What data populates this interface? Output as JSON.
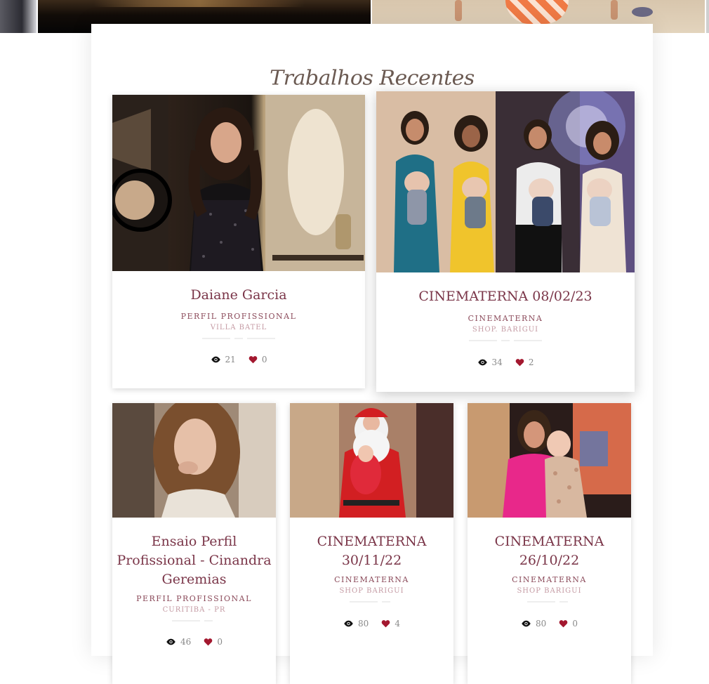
{
  "section": {
    "title": "Trabalhos Recentes"
  },
  "colors": {
    "title": "#7a3548",
    "category": "#8b4a5a",
    "location": "#c49aa3",
    "heart": "#a3182f"
  },
  "icons": {
    "views": "eye-icon",
    "likes": "heart-icon"
  },
  "cards": [
    {
      "title": "Daiane Garcia",
      "category": "PERFIL PROFISSIONAL",
      "location": "VILLA BATEL",
      "views": "21",
      "likes": "0"
    },
    {
      "title": "CINEMATERNA 08/02/23",
      "category": "CINEMATERNA",
      "location": "SHOP. BARIGUI",
      "views": "34",
      "likes": "2"
    },
    {
      "title": "Ensaio Perfil Profissional - Cinandra Geremias",
      "category": "PERFIL PROFISSIONAL",
      "location": "CURITIBA - PR",
      "views": "46",
      "likes": "0"
    },
    {
      "title": "CINEMATERNA 30/11/22",
      "category": "CINEMATERNA",
      "location": "SHOP BARIGUI",
      "views": "80",
      "likes": "4"
    },
    {
      "title": "CINEMATERNA 26/10/22",
      "category": "CINEMATERNA",
      "location": "SHOP BARIGUI",
      "views": "80",
      "likes": "0"
    }
  ]
}
